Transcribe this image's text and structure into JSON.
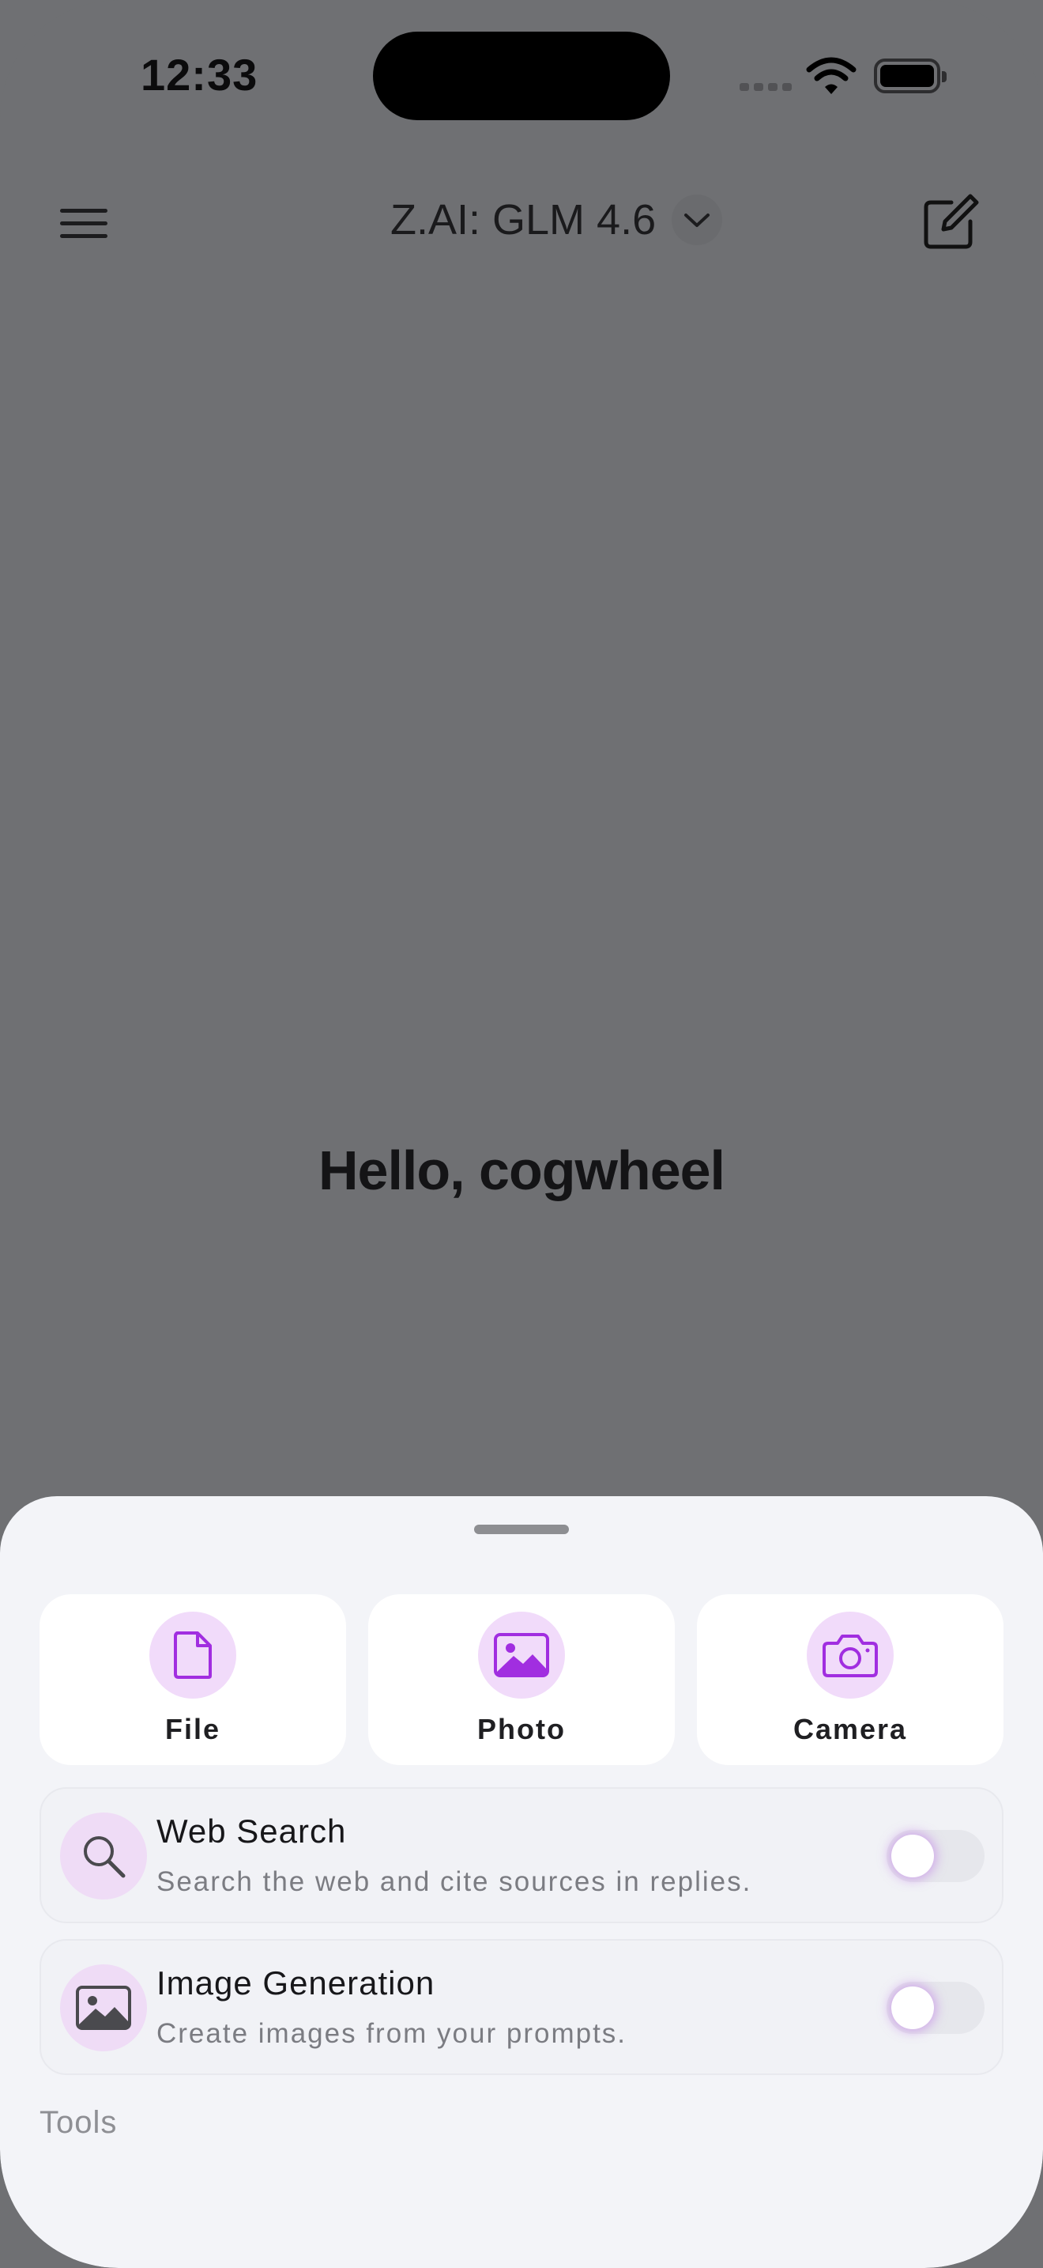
{
  "status_bar": {
    "time": "12:33"
  },
  "header": {
    "model_name": "Z.AI: GLM 4.6"
  },
  "greeting": "Hello, cogwheel",
  "sheet": {
    "attachments": [
      {
        "label": "File",
        "icon": "file-icon"
      },
      {
        "label": "Photo",
        "icon": "photo-icon"
      },
      {
        "label": "Camera",
        "icon": "camera-icon"
      }
    ],
    "features": [
      {
        "title": "Web Search",
        "description": "Search the web and cite sources in replies.",
        "icon": "search-icon",
        "enabled": false
      },
      {
        "title": "Image Generation",
        "description": "Create images from your prompts.",
        "icon": "image-icon",
        "enabled": false
      }
    ],
    "section_label": "Tools"
  },
  "colors": {
    "accent": "#a12ee0",
    "accent_bg": "#f1dbfa",
    "backdrop": "#6f7073",
    "sheet": "#f3f4f8"
  }
}
